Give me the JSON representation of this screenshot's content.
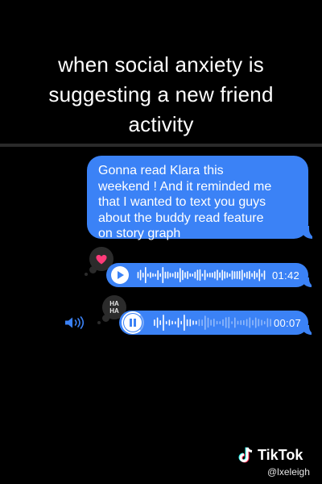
{
  "caption": {
    "lines": [
      "when social anxiety is",
      "suggesting a new friend",
      "activity"
    ]
  },
  "message": {
    "lines": [
      "Gonna read Klara this",
      "weekend ! And it reminded me",
      "that I wanted to text you guys",
      "about the buddy read feature",
      "on story graph"
    ]
  },
  "reactions": {
    "heart": "heart-icon",
    "haha_label": [
      "HA",
      "HA"
    ]
  },
  "audio_messages": [
    {
      "control": "play",
      "duration": "01:42"
    },
    {
      "control": "pause",
      "duration": "00:07",
      "progress": 0.06
    }
  ],
  "watermark": {
    "brand": "TikTok",
    "user": "@lxeleigh"
  },
  "colors": {
    "bubble": "#3b82f6",
    "background": "#000000",
    "heart": "#ff3b7a"
  }
}
